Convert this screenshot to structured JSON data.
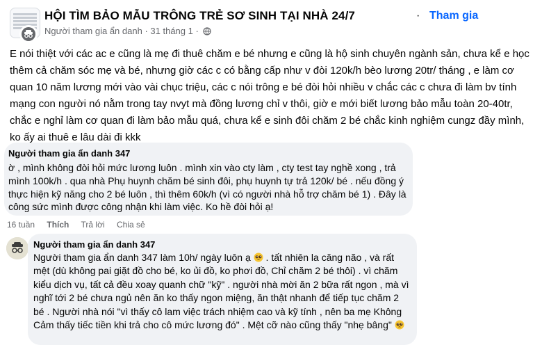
{
  "group": {
    "name": "HỘI TÌM BẢO MẪU TRÔNG TRẺ SƠ SINH TẠI NHÀ 24/7",
    "separator": "·",
    "join_label": "Tham gia"
  },
  "post": {
    "author": "Người tham gia ẩn danh",
    "date": "31 tháng 1",
    "meta_separator": "·",
    "body": "E nói thiệt với các ac e cũng là mẹ đi thuê chăm e bé nhưng e cũng là hộ sinh chuyên ngành sản, chưa kể e học thêm cả chăm sóc mẹ và bé, nhưng giờ các c có bằng cấp như v đòi 120k/h bèo lương 20tr/ tháng , e làm cơ quan 10 năm lương mới vào vài chục triệu, các c nói trông e bé đòi hỏi nhiều v chắc các c chưa đi làm bv tính mạng con người nó nằm trong tay nvyt mà đồng lương chỉ v thôi, giờ e mới biết lương bảo mẫu toàn 20-40tr, chắc e nghỉ làm cơ quan đi làm bảo mẫu quá, chưa kể e sinh đôi chăm 2 bé chắc kinh nghiệm cungz đầy mình, ko ấy ai thuê e lâu dài đi kkk"
  },
  "comment1": {
    "author": "Người tham gia ẩn danh 347",
    "text": "ờ , mình không đòi hỏi mức lương luôn . mình xin vào cty làm , cty test tay nghề xong , trả mình 100k/h . qua nhà Phụ huynh chăm bé sinh đôi, phụ huynh tự trả 120k/ bé . nếu đồng ý thực hiện kỹ năng cho 2 bé luôn , thì thêm 60k/h (vì có người nhà hỗ trợ chăm bé 1) . Đây là công sức mình được công nhận khi làm việc. Ko hề đòi hỏi ạ!",
    "time": "16 tuần",
    "like_label": "Thích",
    "reply_label": "Trả lời",
    "share_label": "Chia sẻ"
  },
  "comment2": {
    "author": "Người tham gia ẩn danh 347",
    "text_part1": "Người tham gia ẩn danh 347 làm 10h/ ngày luôn ạ ",
    "text_part2": " . tất nhiên la căng não , và rất mệt (dù không pai giặt đồ cho bé, ko ủi đồ, ko phơi đồ, Chỉ chăm 2 bé thôi) . vì chăm kiểu dịch vụ, tất cả đều xoay quanh chữ \"kỹ\" . người nhà mời ăn 2 bữa rất ngon , mà vì nghĩ tới 2 bé chưa ngủ nên ăn ko thấy ngon miệng, ăn thật nhanh để tiếp tục chăm 2 bé . Người nhà nói \"vì thấy cô lam việc trách nhiệm cao và kỹ tính , nên ba mẹ Không Cảm thấy tiếc tiền khi trả cho cô mức lương đó\" . Mệt cỡ nào cũng thấy \"nhẹ bâng\" ",
    "emoji_1": "pleading-face-icon",
    "emoji_2": "pleading-face-icon"
  },
  "colors": {
    "link": "#0866ff",
    "meta": "#65676b",
    "bubble": "#f0f2f5"
  }
}
